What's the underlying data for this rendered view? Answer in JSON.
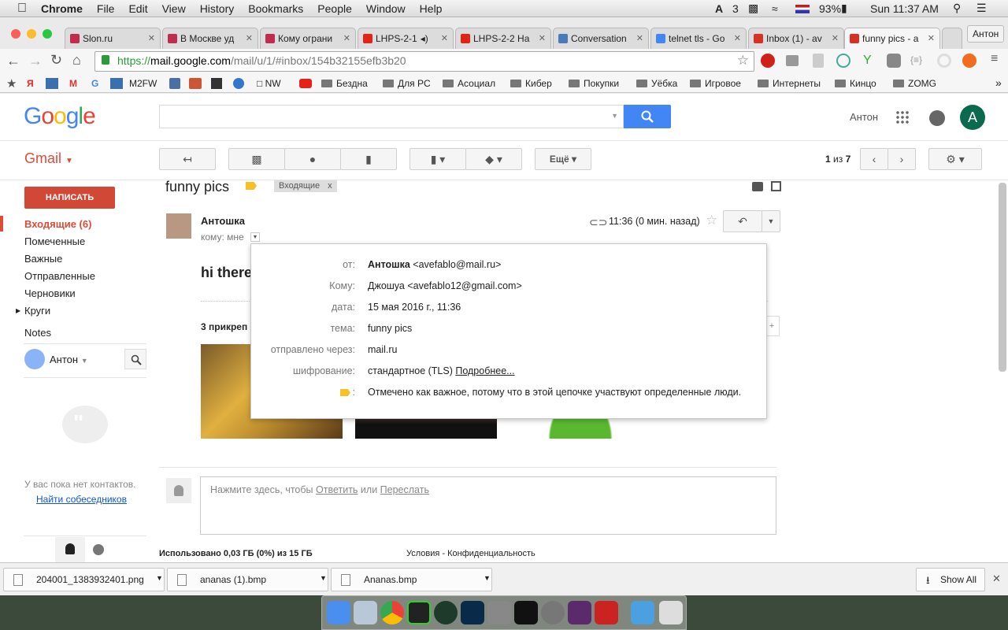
{
  "menubar": {
    "apple": "",
    "app": "Chrome",
    "items": [
      "File",
      "Edit",
      "View",
      "History",
      "Bookmarks",
      "People",
      "Window",
      "Help"
    ],
    "status": {
      "adobe": "3",
      "battery": "93%",
      "clock": "Sun 11:37 AM"
    }
  },
  "tabs": [
    {
      "label": "Slon.ru",
      "fav": "#c12b4e"
    },
    {
      "label": "В Москве уд",
      "fav": "#c12b4e"
    },
    {
      "label": "Кому ограни",
      "fav": "#c12b4e"
    },
    {
      "label": "LHPS-2-1",
      "fav": "#e62117"
    },
    {
      "label": "LHPS-2-2 На",
      "fav": "#e62117"
    },
    {
      "label": "Conversation",
      "fav": "#4a7ab8"
    },
    {
      "label": "telnet tls - Go",
      "fav": "#4285f4"
    },
    {
      "label": "Inbox (1) - av",
      "fav": "#d93025"
    },
    {
      "label": "funny pics - a",
      "fav": "#d93025"
    }
  ],
  "profile_name": "Антон",
  "url": {
    "scheme": "https://",
    "host": "mail.google.com",
    "path": "/mail/u/1/#inbox/154b32155efb3b20"
  },
  "bookmarks": [
    "M2FW",
    "NW",
    "Бездна",
    "Для PC",
    "Асоциал",
    "Кибер",
    "Покупки",
    "Уёбка",
    "Игровое",
    "Интернеты",
    "Кинцо",
    "ZOMG"
  ],
  "bookmark_icons_extra": "»",
  "google": {
    "logo": "Google",
    "user": "Антон",
    "avatar_letter": "A"
  },
  "gmail": {
    "label": "Gmail",
    "compose": "НАПИСАТЬ",
    "nav": [
      "Входящие (6)",
      "Помеченные",
      "Важные",
      "Отправленные",
      "Черновики",
      "Круги",
      "Notes"
    ],
    "chat_user": "Антон",
    "no_contacts": "У вас пока нет контактов.",
    "find_people": "Найти собеседников",
    "more_btn": "Ещё",
    "pager": "1 из 7",
    "pager_bold_first": "1",
    "pager_rest": "из",
    "pager_bold_last": "7"
  },
  "thread": {
    "subject": "funny pics",
    "label_chip": "Входящие",
    "label_chip_x": "x",
    "sender": "Антошка",
    "to_line": "кому: мне",
    "time": "11:36 (0 мин. назад)",
    "greeting": "hi there",
    "attachments_head": "3 прикреп",
    "reply_prompt_pre": "Нажмите здесь, чтобы ",
    "reply_link": "Ответить",
    "reply_mid": " или ",
    "forward_link": "Переслать",
    "usage": "Использовано 0,03 ГБ (0%) из 15 ГБ",
    "terms": "Условия - Конфиденциальность"
  },
  "details": [
    {
      "label": "от:",
      "value_bold": "Антошка",
      "value": " <avefablo@mail.ru>"
    },
    {
      "label": "Кому:",
      "value": "Джошуа <avefablo12@gmail.com>"
    },
    {
      "label": "дата:",
      "value": "15 мая 2016 г., 11:36"
    },
    {
      "label": "тема:",
      "value": "funny pics"
    },
    {
      "label": "отправлено через:",
      "value": "mail.ru"
    },
    {
      "label": "шифрование:",
      "value": "стандартное (TLS) ",
      "link": "Подробнее..."
    },
    {
      "label": ":",
      "value": "Отмечено как важное, потому что в этой цепочке участвуют определенные люди."
    }
  ],
  "downloads": {
    "items": [
      "204001_1383932401.png",
      "ananas (1).bmp",
      "Ananas.bmp"
    ],
    "show_all": "Show All"
  },
  "colors": {
    "gmail_red": "#dd4b39",
    "blue_btn": "#4285f4",
    "link": "#1155cc",
    "important": "#f6c026"
  }
}
